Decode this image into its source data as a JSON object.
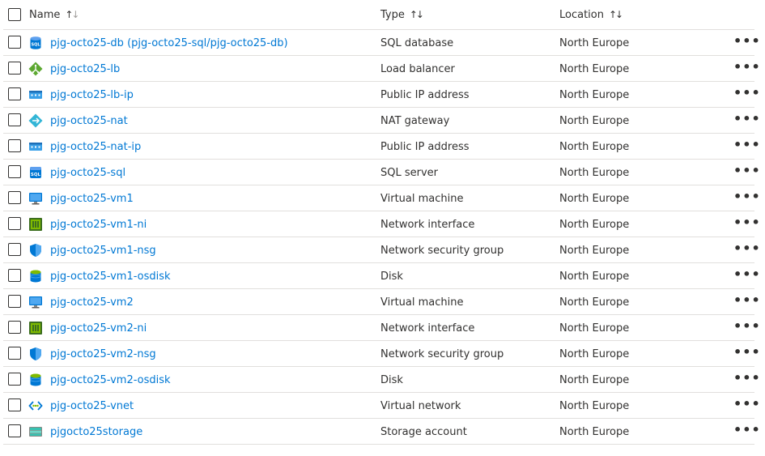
{
  "header": {
    "name": "Name",
    "type": "Type",
    "location": "Location",
    "sort_glyph_up": "↑",
    "sort_glyph_down": "↓"
  },
  "more_glyph": "•••",
  "rows": [
    {
      "name": "pjg-octo25-db (pjg-octo25-sql/pjg-octo25-db)",
      "type": "SQL database",
      "location": "North Europe",
      "icon": "sql-database-icon"
    },
    {
      "name": "pjg-octo25-lb",
      "type": "Load balancer",
      "location": "North Europe",
      "icon": "load-balancer-icon"
    },
    {
      "name": "pjg-octo25-lb-ip",
      "type": "Public IP address",
      "location": "North Europe",
      "icon": "public-ip-icon"
    },
    {
      "name": "pjg-octo25-nat",
      "type": "NAT gateway",
      "location": "North Europe",
      "icon": "nat-gateway-icon"
    },
    {
      "name": "pjg-octo25-nat-ip",
      "type": "Public IP address",
      "location": "North Europe",
      "icon": "public-ip-icon"
    },
    {
      "name": "pjg-octo25-sql",
      "type": "SQL server",
      "location": "North Europe",
      "icon": "sql-server-icon"
    },
    {
      "name": "pjg-octo25-vm1",
      "type": "Virtual machine",
      "location": "North Europe",
      "icon": "virtual-machine-icon"
    },
    {
      "name": "pjg-octo25-vm1-ni",
      "type": "Network interface",
      "location": "North Europe",
      "icon": "network-interface-icon"
    },
    {
      "name": "pjg-octo25-vm1-nsg",
      "type": "Network security group",
      "location": "North Europe",
      "icon": "nsg-shield-icon"
    },
    {
      "name": "pjg-octo25-vm1-osdisk",
      "type": "Disk",
      "location": "North Europe",
      "icon": "disk-icon"
    },
    {
      "name": "pjg-octo25-vm2",
      "type": "Virtual machine",
      "location": "North Europe",
      "icon": "virtual-machine-icon"
    },
    {
      "name": "pjg-octo25-vm2-ni",
      "type": "Network interface",
      "location": "North Europe",
      "icon": "network-interface-icon"
    },
    {
      "name": "pjg-octo25-vm2-nsg",
      "type": "Network security group",
      "location": "North Europe",
      "icon": "nsg-shield-icon"
    },
    {
      "name": "pjg-octo25-vm2-osdisk",
      "type": "Disk",
      "location": "North Europe",
      "icon": "disk-icon"
    },
    {
      "name": "pjg-octo25-vnet",
      "type": "Virtual network",
      "location": "North Europe",
      "icon": "virtual-network-icon"
    },
    {
      "name": "pjgocto25storage",
      "type": "Storage account",
      "location": "North Europe",
      "icon": "storage-account-icon"
    }
  ]
}
